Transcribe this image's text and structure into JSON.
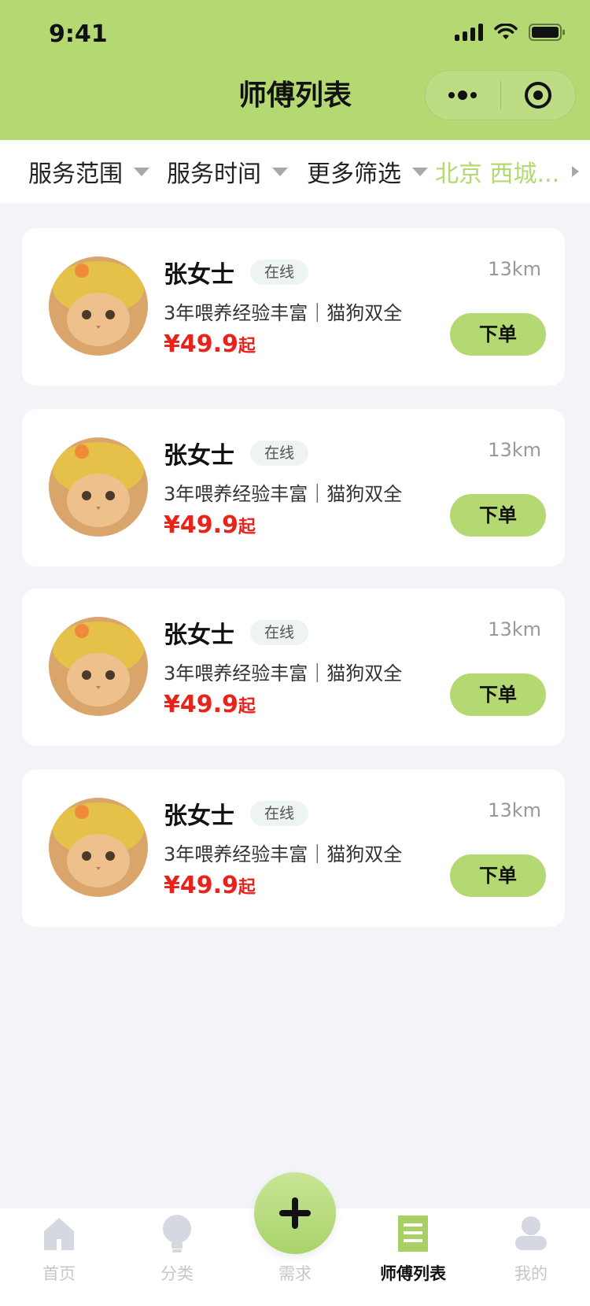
{
  "status_bar": {
    "time": "9:41"
  },
  "nav": {
    "title": "师傅列表"
  },
  "filters": {
    "service_range": "服务范围",
    "service_time": "服务时间",
    "more_filters": "更多筛选",
    "location": "北京 西城..."
  },
  "providers": [
    {
      "name": "张女士",
      "status": "在线",
      "distance": "13km",
      "description": "3年喂养经验丰富｜猫狗双全",
      "price": "¥49.9",
      "price_suffix": "起",
      "order_label": "下单"
    },
    {
      "name": "张女士",
      "status": "在线",
      "distance": "13km",
      "description": "3年喂养经验丰富｜猫狗双全",
      "price": "¥49.9",
      "price_suffix": "起",
      "order_label": "下单"
    },
    {
      "name": "张女士",
      "status": "在线",
      "distance": "13km",
      "description": "3年喂养经验丰富｜猫狗双全",
      "price": "¥49.9",
      "price_suffix": "起",
      "order_label": "下单"
    },
    {
      "name": "张女士",
      "status": "在线",
      "distance": "13km",
      "description": "3年喂养经验丰富｜猫狗双全",
      "price": "¥49.9",
      "price_suffix": "起",
      "order_label": "下单"
    }
  ],
  "tabbar": {
    "items": [
      {
        "label": "首页",
        "icon": "home-icon"
      },
      {
        "label": "分类",
        "icon": "lightbulb-icon"
      },
      {
        "label": "需求",
        "icon": "plus-icon"
      },
      {
        "label": "师傅列表",
        "icon": "list-icon",
        "active": true
      },
      {
        "label": "我的",
        "icon": "profile-icon"
      }
    ]
  },
  "colors": {
    "accent": "#b4d872",
    "price": "#e8231c",
    "background": "#f3f4f8"
  }
}
